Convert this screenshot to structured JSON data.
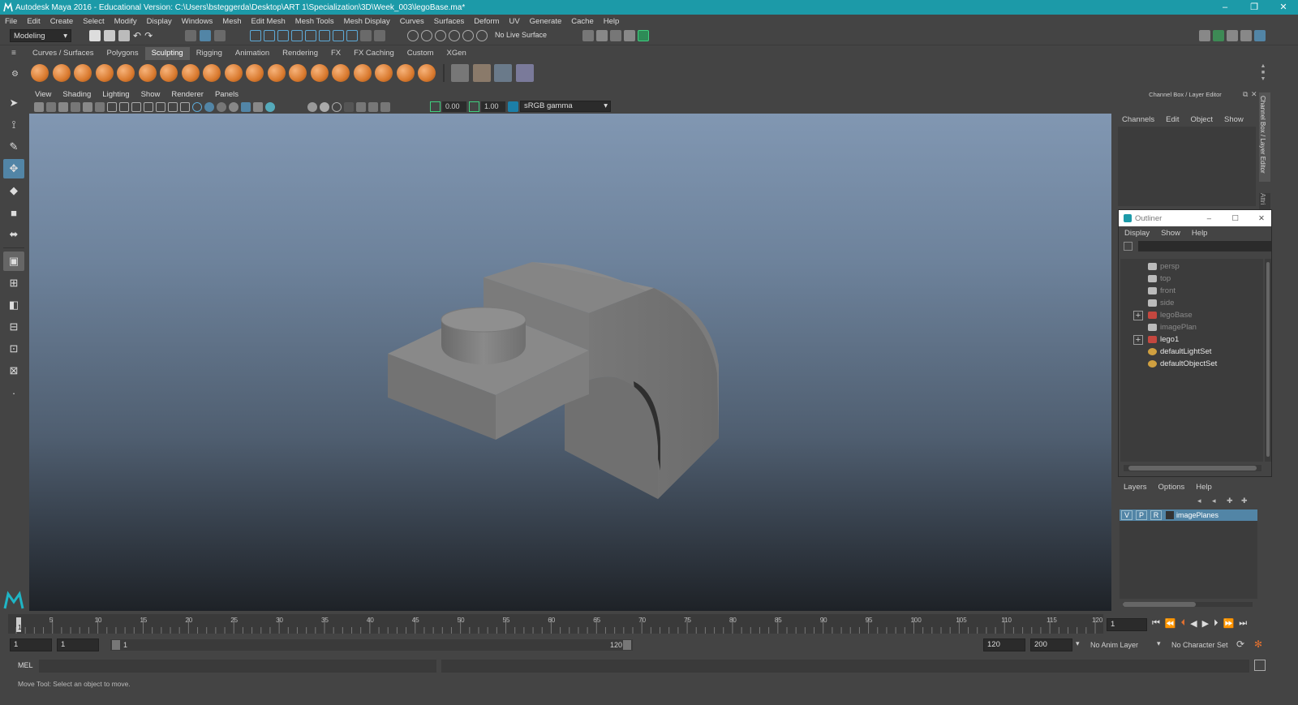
{
  "window": {
    "title": "Autodesk Maya 2016 - Educational Version: C:\\Users\\bsteggerda\\Desktop\\ART 1\\Specialization\\3D\\Week_003\\legoBase.ma*",
    "controls": [
      "–",
      "❐",
      "✕"
    ]
  },
  "menu": [
    "File",
    "Edit",
    "Create",
    "Select",
    "Modify",
    "Display",
    "Windows",
    "Mesh",
    "Edit Mesh",
    "Mesh Tools",
    "Mesh Display",
    "Curves",
    "Surfaces",
    "Deform",
    "UV",
    "Generate",
    "Cache",
    "Help"
  ],
  "status_line": {
    "menuset": "Modeling",
    "live_surface": "No Live Surface"
  },
  "shelf": {
    "tabs": [
      "Curves / Surfaces",
      "Polygons",
      "Sculpting",
      "Rigging",
      "Animation",
      "Rendering",
      "FX",
      "FX Caching",
      "Custom",
      "XGen"
    ],
    "active_tab": "Sculpting"
  },
  "viewport": {
    "menu": [
      "View",
      "Shading",
      "Lighting",
      "Show",
      "Renderer",
      "Panels"
    ],
    "exposure": "0.00",
    "gamma": "1.00",
    "color_space": "sRGB gamma"
  },
  "channel_box": {
    "title": "Channel Box / Layer Editor",
    "menu": [
      "Channels",
      "Edit",
      "Object",
      "Show"
    ],
    "side_tab": "Channel Box / Layer Editor",
    "side_tab2": "Attri"
  },
  "outliner": {
    "title": "Outliner",
    "menu": [
      "Display",
      "Show",
      "Help"
    ],
    "items": [
      {
        "label": "persp",
        "dim": true,
        "expand": false,
        "icon": "camera-icon"
      },
      {
        "label": "top",
        "dim": true,
        "expand": false,
        "icon": "camera-icon"
      },
      {
        "label": "front",
        "dim": true,
        "expand": false,
        "icon": "camera-icon"
      },
      {
        "label": "side",
        "dim": true,
        "expand": false,
        "icon": "camera-icon"
      },
      {
        "label": "legoBase",
        "dim": true,
        "expand": true,
        "icon": "mesh-icon"
      },
      {
        "label": "imagePlan",
        "dim": true,
        "expand": false,
        "icon": "image-plane-icon"
      },
      {
        "label": "lego1",
        "dim": false,
        "expand": true,
        "icon": "mesh-icon"
      },
      {
        "label": "defaultLightSet",
        "dim": false,
        "expand": false,
        "icon": "set-icon"
      },
      {
        "label": "defaultObjectSet",
        "dim": false,
        "expand": false,
        "icon": "set-icon"
      }
    ]
  },
  "layers": {
    "menu": [
      "Layers",
      "Options",
      "Help"
    ],
    "rows": [
      {
        "v": "V",
        "p": "P",
        "r": "R",
        "name": "imagePlanes"
      }
    ]
  },
  "timeline": {
    "ticks": [
      "5",
      "10",
      "15",
      "20",
      "25",
      "30",
      "35",
      "40",
      "45",
      "50",
      "55",
      "60",
      "65",
      "70",
      "75",
      "80",
      "85",
      "90",
      "95",
      "100",
      "105",
      "110",
      "115",
      "120"
    ],
    "start_label": "1",
    "current_frame": "1"
  },
  "range": {
    "start": "1",
    "anim_start": "1",
    "slider_start": "1",
    "slider_end": "120",
    "anim_end": "120",
    "end": "200",
    "anim_layer": "No Anim Layer",
    "char_set": "No Character Set"
  },
  "command": {
    "label": "MEL"
  },
  "help_line": "Move Tool: Select an object to move.",
  "colors": {
    "accent": "#1c9aa8",
    "tool_active": "#5285a6",
    "orb": "#d97a2f"
  }
}
